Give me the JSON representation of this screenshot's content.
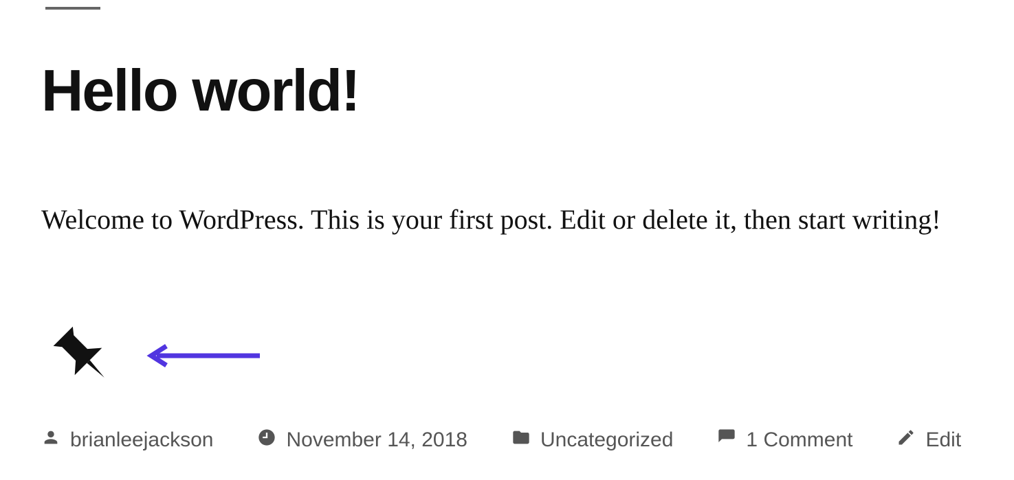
{
  "post": {
    "title": "Hello world!",
    "body": "Welcome to WordPress. This is your first post. Edit or delete it, then start writing!"
  },
  "meta": {
    "author": "brianleejackson",
    "date": "November 14, 2018",
    "category": "Uncategorized",
    "comments": "1 Comment",
    "edit": "Edit"
  },
  "annotation": {
    "arrow_color": "#5135E0"
  }
}
